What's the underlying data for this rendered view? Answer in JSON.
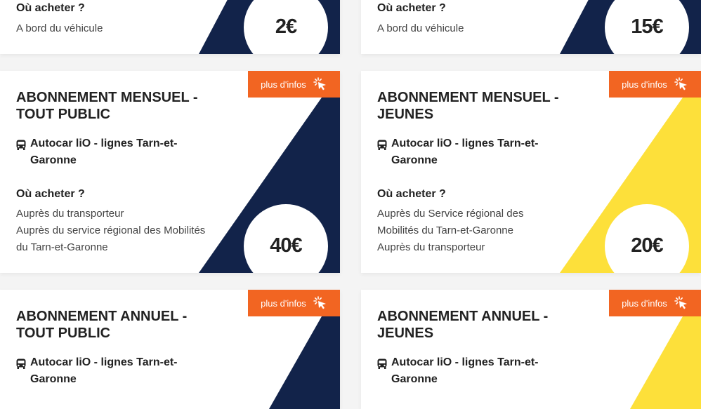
{
  "colors": {
    "navy": "#12234a",
    "yellow": "#fde03a",
    "orange": "#f26522",
    "card_bg": "#ffffff",
    "page_bg": "#f4f4f4"
  },
  "where_label": "Où acheter ?",
  "more_info_label": "plus d'infos",
  "icons": {
    "bus": "bus-icon",
    "more_info": "click-pointer-icon"
  },
  "cards": [
    {
      "price": "2€",
      "theme": "navy",
      "where": [
        "A bord du véhicule"
      ]
    },
    {
      "price": "15€",
      "theme": "navy",
      "where": [
        "A bord du véhicule"
      ]
    },
    {
      "title": "ABONNEMENT MENSUEL - TOUT PUBLIC",
      "line": "Autocar liO - lignes Tarn-et-Garonne",
      "price": "40€",
      "theme": "navy",
      "where": [
        "Auprès du transporteur",
        "Auprès du service régional des Mobilités du Tarn-et-Garonne"
      ]
    },
    {
      "title": "ABONNEMENT MENSUEL - JEUNES",
      "line": "Autocar liO - lignes Tarn-et-Garonne",
      "price": "20€",
      "theme": "yellow",
      "where": [
        "Auprès du Service régional des Mobilités du Tarn-et-Garonne",
        "Auprès du transporteur"
      ]
    },
    {
      "title": "ABONNEMENT ANNUEL - TOUT PUBLIC",
      "line": "Autocar liO - lignes Tarn-et-Garonne",
      "theme": "navy"
    },
    {
      "title": "ABONNEMENT ANNUEL - JEUNES",
      "line": "Autocar liO - lignes Tarn-et-Garonne",
      "theme": "yellow"
    }
  ]
}
